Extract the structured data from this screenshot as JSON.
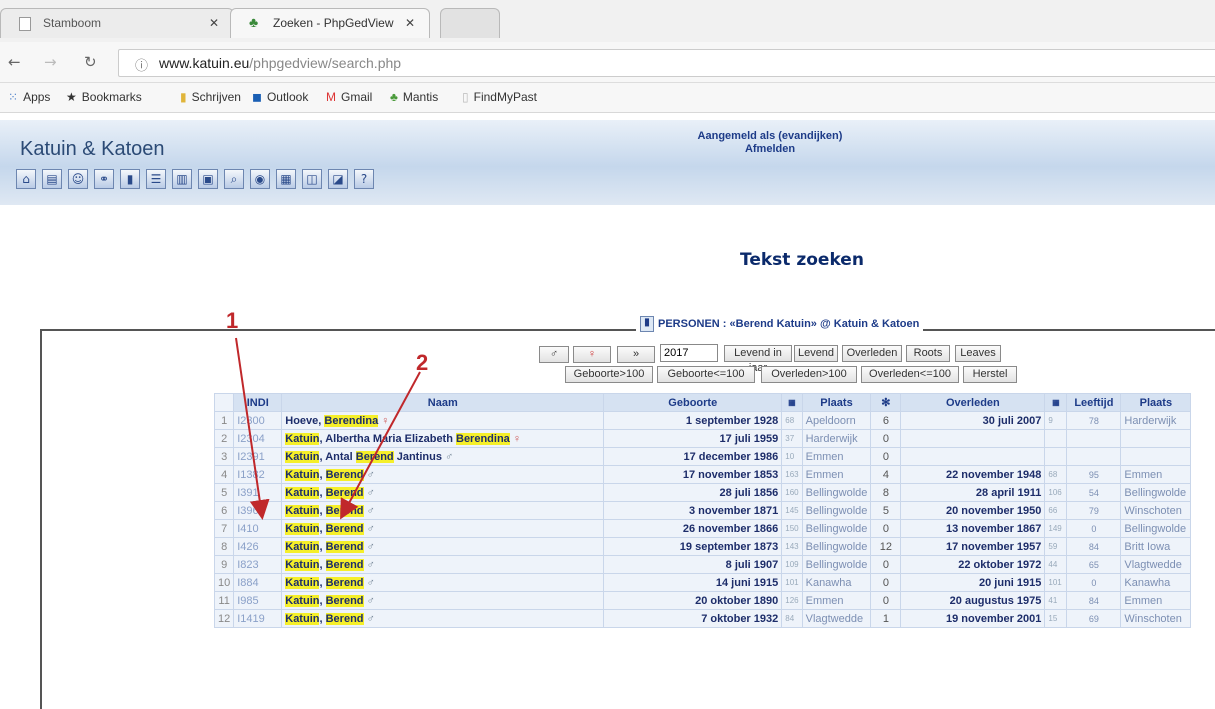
{
  "browser": {
    "tabs": [
      {
        "title": "Stamboom"
      },
      {
        "title": "Zoeken - PhpGedView"
      }
    ],
    "url_host": "www.katuin.eu",
    "url_path": "/phpgedview/search.php",
    "bookmarks": [
      "Apps",
      "Bookmarks",
      "Schrijven",
      "Outlook",
      "Gmail",
      "Mantis",
      "FindMyPast"
    ]
  },
  "site": {
    "title": "Katuin & Katoen",
    "login_line": "Aangemeld als (evandijken)",
    "logout": "Afmelden"
  },
  "search": {
    "heading": "Tekst zoeken",
    "legend": "PERSONEN : «Berend Katuin» @ Katuin & Katoen",
    "year_value": "2017",
    "filters_row1": [
      "♂",
      "♀",
      "»",
      "Levend in jaar",
      "Levend",
      "Overleden",
      "Roots",
      "Leaves"
    ],
    "filters_row2": [
      "Geboorte>100",
      "Geboorte<=100",
      "Overleden>100",
      "Overleden<=100",
      "Herstel"
    ]
  },
  "table": {
    "headers": {
      "indi": "INDI",
      "naam": "Naam",
      "geboorte": "Geboorte",
      "plaats1": "Plaats",
      "overleden": "Overleden",
      "leeftijd": "Leeftijd",
      "plaats2": "Plaats"
    },
    "rows": [
      {
        "no": "1",
        "id": "I2300",
        "name": "Hoeve, Berendina",
        "sex": "♀",
        "birth": "1 september 1928",
        "bn": "68",
        "bplace": "Apeldoorn",
        "children": "6",
        "death": "30 juli 2007",
        "dn": "9",
        "age": "78",
        "dplace": "Harderwijk"
      },
      {
        "no": "2",
        "id": "I2304",
        "name": "Katuin, Albertha Maria Elizabeth Berendina",
        "sex": "♀",
        "birth": "17 juli 1959",
        "bn": "37",
        "bplace": "Harderwijk",
        "children": "0",
        "death": "",
        "dn": "",
        "age": "",
        "dplace": ""
      },
      {
        "no": "3",
        "id": "I2391",
        "name": "Katuin, Antal Berend Jantinus",
        "sex": "♂",
        "birth": "17 december 1986",
        "bn": "10",
        "bplace": "Emmen",
        "children": "0",
        "death": "",
        "dn": "",
        "age": "",
        "dplace": ""
      },
      {
        "no": "4",
        "id": "I1382",
        "name": "Katuin, Berend",
        "sex": "♂",
        "birth": "17 november 1853",
        "bn": "163",
        "bplace": "Emmen",
        "children": "4",
        "death": "22 november 1948",
        "dn": "68",
        "age": "95",
        "dplace": "Emmen"
      },
      {
        "no": "5",
        "id": "I391",
        "name": "Katuin, Berend",
        "sex": "♂",
        "birth": "28 juli 1856",
        "bn": "160",
        "bplace": "Bellingwolde",
        "children": "8",
        "death": "28 april 1911",
        "dn": "106",
        "age": "54",
        "dplace": "Bellingwolde"
      },
      {
        "no": "6",
        "id": "I396",
        "name": "Katuin, Berend",
        "sex": "♂",
        "birth": "3 november 1871",
        "bn": "145",
        "bplace": "Bellingwolde",
        "children": "5",
        "death": "20 november 1950",
        "dn": "66",
        "age": "79",
        "dplace": "Winschoten"
      },
      {
        "no": "7",
        "id": "I410",
        "name": "Katuin, Berend",
        "sex": "♂",
        "birth": "26 november 1866",
        "bn": "150",
        "bplace": "Bellingwolde",
        "children": "0",
        "death": "13 november 1867",
        "dn": "149",
        "age": "0",
        "dplace": "Bellingwolde"
      },
      {
        "no": "8",
        "id": "I426",
        "name": "Katuin, Berend",
        "sex": "♂",
        "birth": "19 september 1873",
        "bn": "143",
        "bplace": "Bellingwolde",
        "children": "12",
        "death": "17 november 1957",
        "dn": "59",
        "age": "84",
        "dplace": "Britt Iowa"
      },
      {
        "no": "9",
        "id": "I823",
        "name": "Katuin, Berend",
        "sex": "♂",
        "birth": "8 juli 1907",
        "bn": "109",
        "bplace": "Bellingwolde",
        "children": "0",
        "death": "22 oktober 1972",
        "dn": "44",
        "age": "65",
        "dplace": "Vlagtwedde"
      },
      {
        "no": "10",
        "id": "I884",
        "name": "Katuin, Berend",
        "sex": "♂",
        "birth": "14 juni 1915",
        "bn": "101",
        "bplace": "Kanawha",
        "children": "0",
        "death": "20 juni 1915",
        "dn": "101",
        "age": "0",
        "dplace": "Kanawha"
      },
      {
        "no": "11",
        "id": "I985",
        "name": "Katuin, Berend",
        "sex": "♂",
        "birth": "20 oktober 1890",
        "bn": "126",
        "bplace": "Emmen",
        "children": "0",
        "death": "20 augustus 1975",
        "dn": "41",
        "age": "84",
        "dplace": "Emmen"
      },
      {
        "no": "12",
        "id": "I1419",
        "name": "Katuin, Berend",
        "sex": "♂",
        "birth": "7 oktober 1932",
        "bn": "84",
        "bplace": "Vlagtwedde",
        "children": "1",
        "death": "19 november 2001",
        "dn": "15",
        "age": "69",
        "dplace": "Winschoten"
      }
    ]
  },
  "annotations": {
    "label1": "1",
    "label2": "2",
    "color": "#c0282b"
  }
}
